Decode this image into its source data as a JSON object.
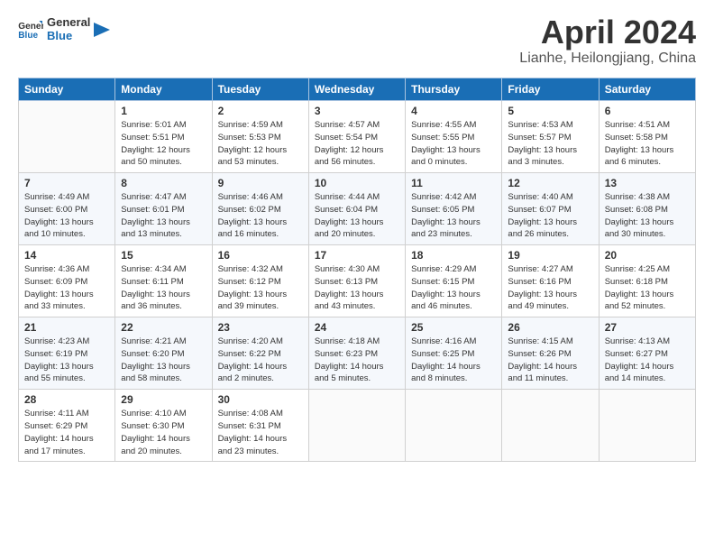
{
  "logo": {
    "line1": "General",
    "line2": "Blue"
  },
  "title": "April 2024",
  "location": "Lianhe, Heilongjiang, China",
  "weekdays": [
    "Sunday",
    "Monday",
    "Tuesday",
    "Wednesday",
    "Thursday",
    "Friday",
    "Saturday"
  ],
  "weeks": [
    [
      {
        "day": "",
        "info": ""
      },
      {
        "day": "1",
        "info": "Sunrise: 5:01 AM\nSunset: 5:51 PM\nDaylight: 12 hours\nand 50 minutes."
      },
      {
        "day": "2",
        "info": "Sunrise: 4:59 AM\nSunset: 5:53 PM\nDaylight: 12 hours\nand 53 minutes."
      },
      {
        "day": "3",
        "info": "Sunrise: 4:57 AM\nSunset: 5:54 PM\nDaylight: 12 hours\nand 56 minutes."
      },
      {
        "day": "4",
        "info": "Sunrise: 4:55 AM\nSunset: 5:55 PM\nDaylight: 13 hours\nand 0 minutes."
      },
      {
        "day": "5",
        "info": "Sunrise: 4:53 AM\nSunset: 5:57 PM\nDaylight: 13 hours\nand 3 minutes."
      },
      {
        "day": "6",
        "info": "Sunrise: 4:51 AM\nSunset: 5:58 PM\nDaylight: 13 hours\nand 6 minutes."
      }
    ],
    [
      {
        "day": "7",
        "info": "Sunrise: 4:49 AM\nSunset: 6:00 PM\nDaylight: 13 hours\nand 10 minutes."
      },
      {
        "day": "8",
        "info": "Sunrise: 4:47 AM\nSunset: 6:01 PM\nDaylight: 13 hours\nand 13 minutes."
      },
      {
        "day": "9",
        "info": "Sunrise: 4:46 AM\nSunset: 6:02 PM\nDaylight: 13 hours\nand 16 minutes."
      },
      {
        "day": "10",
        "info": "Sunrise: 4:44 AM\nSunset: 6:04 PM\nDaylight: 13 hours\nand 20 minutes."
      },
      {
        "day": "11",
        "info": "Sunrise: 4:42 AM\nSunset: 6:05 PM\nDaylight: 13 hours\nand 23 minutes."
      },
      {
        "day": "12",
        "info": "Sunrise: 4:40 AM\nSunset: 6:07 PM\nDaylight: 13 hours\nand 26 minutes."
      },
      {
        "day": "13",
        "info": "Sunrise: 4:38 AM\nSunset: 6:08 PM\nDaylight: 13 hours\nand 30 minutes."
      }
    ],
    [
      {
        "day": "14",
        "info": "Sunrise: 4:36 AM\nSunset: 6:09 PM\nDaylight: 13 hours\nand 33 minutes."
      },
      {
        "day": "15",
        "info": "Sunrise: 4:34 AM\nSunset: 6:11 PM\nDaylight: 13 hours\nand 36 minutes."
      },
      {
        "day": "16",
        "info": "Sunrise: 4:32 AM\nSunset: 6:12 PM\nDaylight: 13 hours\nand 39 minutes."
      },
      {
        "day": "17",
        "info": "Sunrise: 4:30 AM\nSunset: 6:13 PM\nDaylight: 13 hours\nand 43 minutes."
      },
      {
        "day": "18",
        "info": "Sunrise: 4:29 AM\nSunset: 6:15 PM\nDaylight: 13 hours\nand 46 minutes."
      },
      {
        "day": "19",
        "info": "Sunrise: 4:27 AM\nSunset: 6:16 PM\nDaylight: 13 hours\nand 49 minutes."
      },
      {
        "day": "20",
        "info": "Sunrise: 4:25 AM\nSunset: 6:18 PM\nDaylight: 13 hours\nand 52 minutes."
      }
    ],
    [
      {
        "day": "21",
        "info": "Sunrise: 4:23 AM\nSunset: 6:19 PM\nDaylight: 13 hours\nand 55 minutes."
      },
      {
        "day": "22",
        "info": "Sunrise: 4:21 AM\nSunset: 6:20 PM\nDaylight: 13 hours\nand 58 minutes."
      },
      {
        "day": "23",
        "info": "Sunrise: 4:20 AM\nSunset: 6:22 PM\nDaylight: 14 hours\nand 2 minutes."
      },
      {
        "day": "24",
        "info": "Sunrise: 4:18 AM\nSunset: 6:23 PM\nDaylight: 14 hours\nand 5 minutes."
      },
      {
        "day": "25",
        "info": "Sunrise: 4:16 AM\nSunset: 6:25 PM\nDaylight: 14 hours\nand 8 minutes."
      },
      {
        "day": "26",
        "info": "Sunrise: 4:15 AM\nSunset: 6:26 PM\nDaylight: 14 hours\nand 11 minutes."
      },
      {
        "day": "27",
        "info": "Sunrise: 4:13 AM\nSunset: 6:27 PM\nDaylight: 14 hours\nand 14 minutes."
      }
    ],
    [
      {
        "day": "28",
        "info": "Sunrise: 4:11 AM\nSunset: 6:29 PM\nDaylight: 14 hours\nand 17 minutes."
      },
      {
        "day": "29",
        "info": "Sunrise: 4:10 AM\nSunset: 6:30 PM\nDaylight: 14 hours\nand 20 minutes."
      },
      {
        "day": "30",
        "info": "Sunrise: 4:08 AM\nSunset: 6:31 PM\nDaylight: 14 hours\nand 23 minutes."
      },
      {
        "day": "",
        "info": ""
      },
      {
        "day": "",
        "info": ""
      },
      {
        "day": "",
        "info": ""
      },
      {
        "day": "",
        "info": ""
      }
    ]
  ]
}
